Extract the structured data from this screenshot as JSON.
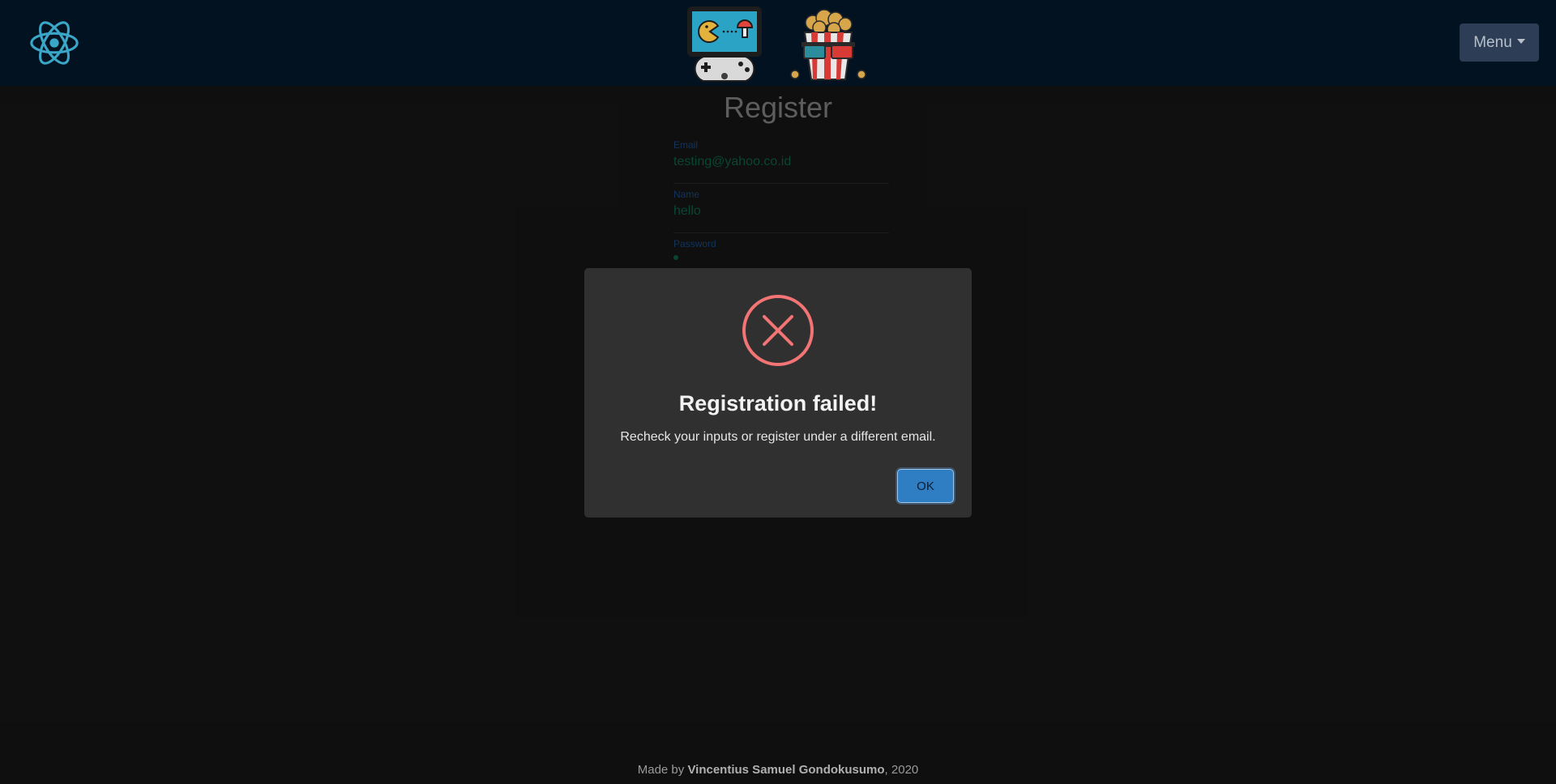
{
  "navbar": {
    "menu_label": "Menu",
    "logo_icon": "react-atom-icon",
    "center_icons": [
      "arcade-game-icon",
      "popcorn-3d-glasses-icon"
    ]
  },
  "register": {
    "title": "Register",
    "email_label": "Email",
    "email_value": "testing@yahoo.co.id",
    "name_label": "Name",
    "name_value": "hello",
    "password_label": "Password"
  },
  "modal": {
    "icon": "error-x-icon",
    "title": "Registration failed!",
    "message": "Recheck your inputs or register under a different email.",
    "ok_label": "OK"
  },
  "footer": {
    "prefix": "Made by ",
    "author": "Vincentius Samuel Gondokusumo",
    "suffix": ", 2020"
  },
  "colors": {
    "navbar_bg": "#031221",
    "page_bg": "#181818",
    "modal_bg": "#303030",
    "error_red": "#f27474",
    "ok_button": "#2f7dc2"
  }
}
